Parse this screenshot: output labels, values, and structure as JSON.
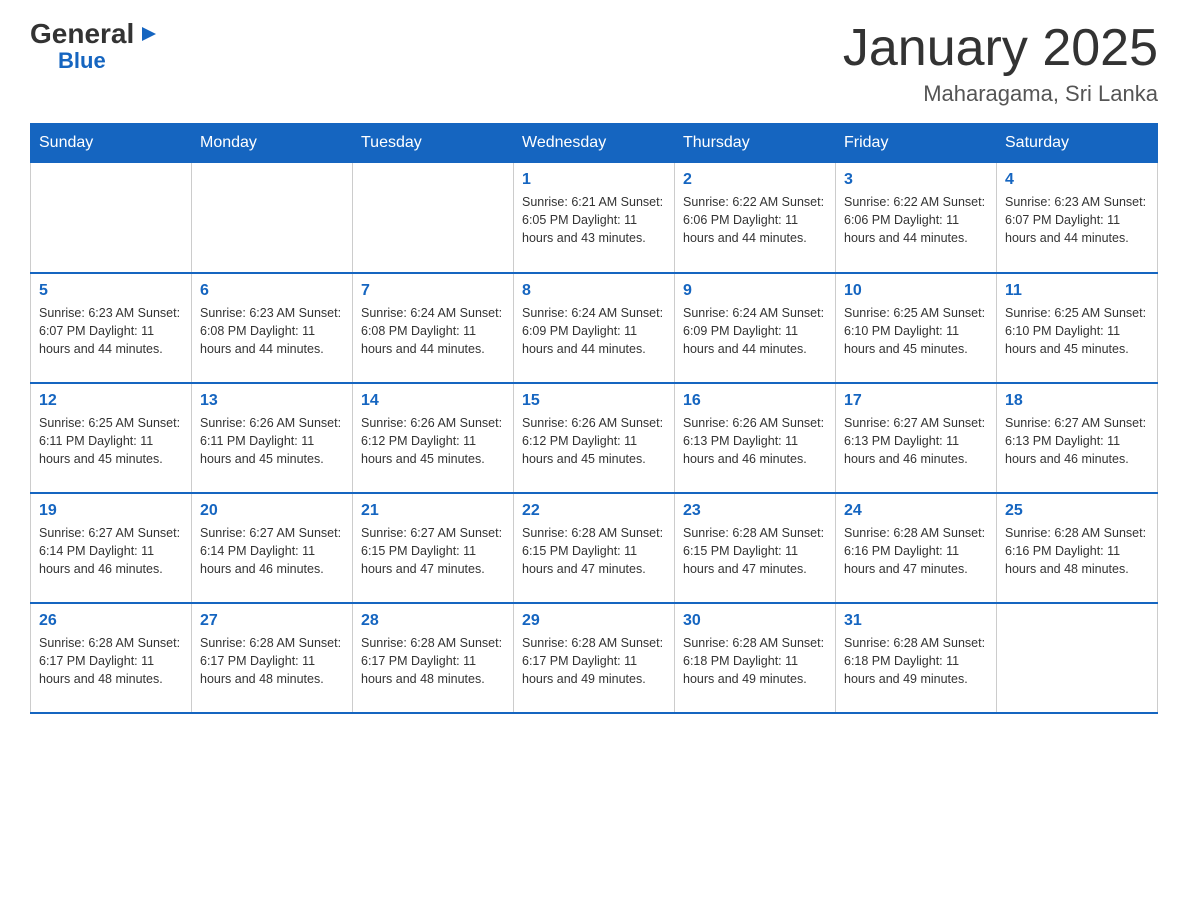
{
  "logo": {
    "general": "General",
    "triangle": "▶",
    "blue": "Blue"
  },
  "header": {
    "month": "January 2025",
    "location": "Maharagama, Sri Lanka"
  },
  "days_of_week": [
    "Sunday",
    "Monday",
    "Tuesday",
    "Wednesday",
    "Thursday",
    "Friday",
    "Saturday"
  ],
  "weeks": [
    [
      {
        "day": "",
        "info": ""
      },
      {
        "day": "",
        "info": ""
      },
      {
        "day": "",
        "info": ""
      },
      {
        "day": "1",
        "info": "Sunrise: 6:21 AM\nSunset: 6:05 PM\nDaylight: 11 hours\nand 43 minutes."
      },
      {
        "day": "2",
        "info": "Sunrise: 6:22 AM\nSunset: 6:06 PM\nDaylight: 11 hours\nand 44 minutes."
      },
      {
        "day": "3",
        "info": "Sunrise: 6:22 AM\nSunset: 6:06 PM\nDaylight: 11 hours\nand 44 minutes."
      },
      {
        "day": "4",
        "info": "Sunrise: 6:23 AM\nSunset: 6:07 PM\nDaylight: 11 hours\nand 44 minutes."
      }
    ],
    [
      {
        "day": "5",
        "info": "Sunrise: 6:23 AM\nSunset: 6:07 PM\nDaylight: 11 hours\nand 44 minutes."
      },
      {
        "day": "6",
        "info": "Sunrise: 6:23 AM\nSunset: 6:08 PM\nDaylight: 11 hours\nand 44 minutes."
      },
      {
        "day": "7",
        "info": "Sunrise: 6:24 AM\nSunset: 6:08 PM\nDaylight: 11 hours\nand 44 minutes."
      },
      {
        "day": "8",
        "info": "Sunrise: 6:24 AM\nSunset: 6:09 PM\nDaylight: 11 hours\nand 44 minutes."
      },
      {
        "day": "9",
        "info": "Sunrise: 6:24 AM\nSunset: 6:09 PM\nDaylight: 11 hours\nand 44 minutes."
      },
      {
        "day": "10",
        "info": "Sunrise: 6:25 AM\nSunset: 6:10 PM\nDaylight: 11 hours\nand 45 minutes."
      },
      {
        "day": "11",
        "info": "Sunrise: 6:25 AM\nSunset: 6:10 PM\nDaylight: 11 hours\nand 45 minutes."
      }
    ],
    [
      {
        "day": "12",
        "info": "Sunrise: 6:25 AM\nSunset: 6:11 PM\nDaylight: 11 hours\nand 45 minutes."
      },
      {
        "day": "13",
        "info": "Sunrise: 6:26 AM\nSunset: 6:11 PM\nDaylight: 11 hours\nand 45 minutes."
      },
      {
        "day": "14",
        "info": "Sunrise: 6:26 AM\nSunset: 6:12 PM\nDaylight: 11 hours\nand 45 minutes."
      },
      {
        "day": "15",
        "info": "Sunrise: 6:26 AM\nSunset: 6:12 PM\nDaylight: 11 hours\nand 45 minutes."
      },
      {
        "day": "16",
        "info": "Sunrise: 6:26 AM\nSunset: 6:13 PM\nDaylight: 11 hours\nand 46 minutes."
      },
      {
        "day": "17",
        "info": "Sunrise: 6:27 AM\nSunset: 6:13 PM\nDaylight: 11 hours\nand 46 minutes."
      },
      {
        "day": "18",
        "info": "Sunrise: 6:27 AM\nSunset: 6:13 PM\nDaylight: 11 hours\nand 46 minutes."
      }
    ],
    [
      {
        "day": "19",
        "info": "Sunrise: 6:27 AM\nSunset: 6:14 PM\nDaylight: 11 hours\nand 46 minutes."
      },
      {
        "day": "20",
        "info": "Sunrise: 6:27 AM\nSunset: 6:14 PM\nDaylight: 11 hours\nand 46 minutes."
      },
      {
        "day": "21",
        "info": "Sunrise: 6:27 AM\nSunset: 6:15 PM\nDaylight: 11 hours\nand 47 minutes."
      },
      {
        "day": "22",
        "info": "Sunrise: 6:28 AM\nSunset: 6:15 PM\nDaylight: 11 hours\nand 47 minutes."
      },
      {
        "day": "23",
        "info": "Sunrise: 6:28 AM\nSunset: 6:15 PM\nDaylight: 11 hours\nand 47 minutes."
      },
      {
        "day": "24",
        "info": "Sunrise: 6:28 AM\nSunset: 6:16 PM\nDaylight: 11 hours\nand 47 minutes."
      },
      {
        "day": "25",
        "info": "Sunrise: 6:28 AM\nSunset: 6:16 PM\nDaylight: 11 hours\nand 48 minutes."
      }
    ],
    [
      {
        "day": "26",
        "info": "Sunrise: 6:28 AM\nSunset: 6:17 PM\nDaylight: 11 hours\nand 48 minutes."
      },
      {
        "day": "27",
        "info": "Sunrise: 6:28 AM\nSunset: 6:17 PM\nDaylight: 11 hours\nand 48 minutes."
      },
      {
        "day": "28",
        "info": "Sunrise: 6:28 AM\nSunset: 6:17 PM\nDaylight: 11 hours\nand 48 minutes."
      },
      {
        "day": "29",
        "info": "Sunrise: 6:28 AM\nSunset: 6:17 PM\nDaylight: 11 hours\nand 49 minutes."
      },
      {
        "day": "30",
        "info": "Sunrise: 6:28 AM\nSunset: 6:18 PM\nDaylight: 11 hours\nand 49 minutes."
      },
      {
        "day": "31",
        "info": "Sunrise: 6:28 AM\nSunset: 6:18 PM\nDaylight: 11 hours\nand 49 minutes."
      },
      {
        "day": "",
        "info": ""
      }
    ]
  ]
}
